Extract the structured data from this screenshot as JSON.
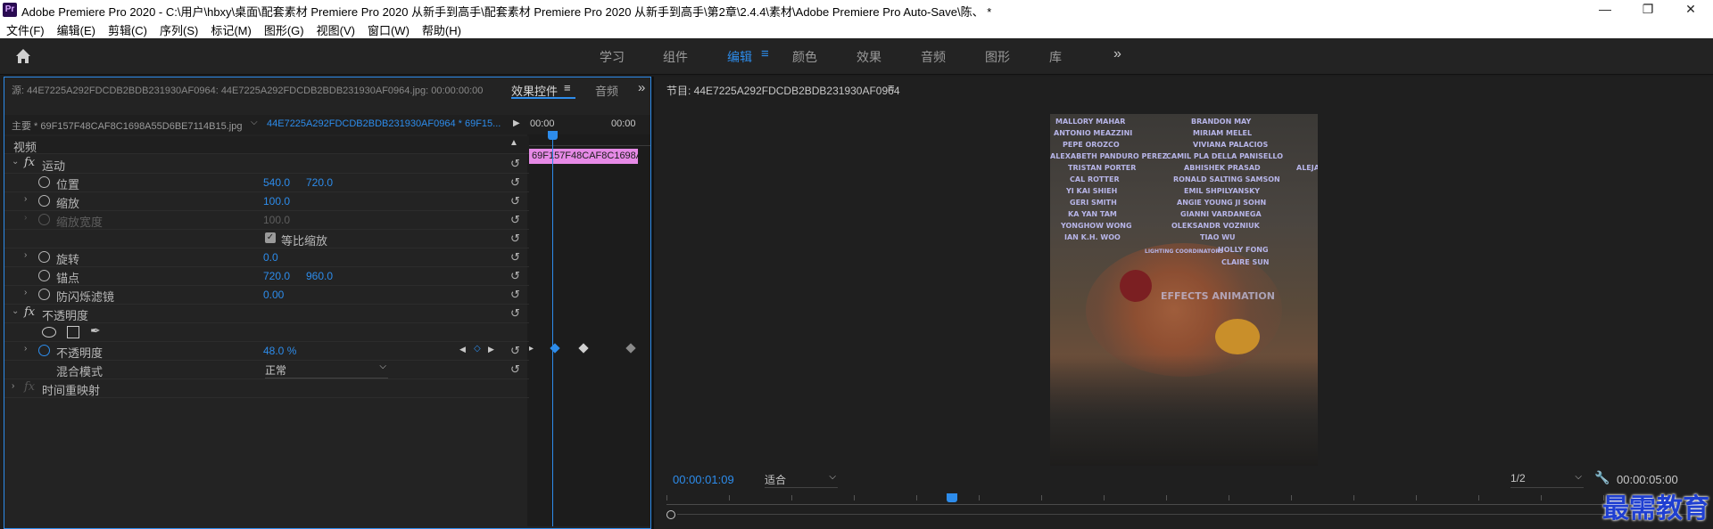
{
  "titlebar": {
    "icon": "Pr",
    "title": "Adobe Premiere Pro 2020 - C:\\用户\\hbxy\\桌面\\配套素材 Premiere Pro 2020 从新手到高手\\配套素材 Premiere Pro 2020 从新手到高手\\第2章\\2.4.4\\素材\\Adobe Premiere Pro Auto-Save\\陈、 *",
    "minimize": "—",
    "maximize": "❐",
    "close": "✕"
  },
  "menu": [
    "文件(F)",
    "编辑(E)",
    "剪辑(C)",
    "序列(S)",
    "标记(M)",
    "图形(G)",
    "视图(V)",
    "窗口(W)",
    "帮助(H)"
  ],
  "workspaces": {
    "items": [
      "学习",
      "组件",
      "编辑",
      "颜色",
      "效果",
      "音频",
      "图形",
      "库"
    ],
    "active": "编辑",
    "more": "»"
  },
  "left_panel": {
    "source_tab": "源: 44E7225A292FDCDB2BDB231930AF0964: 44E7225A292FDCDB2BDB231930AF0964.jpg: 00:00:00:00",
    "effect_controls_tab": "效果控件",
    "audio_tab": "音频",
    "more": "»",
    "master_clip": "主要 * 69F157F48CAF8C1698A55D6BE7114B15.jpg",
    "sequence_clip": "44E7225A292FDCDB2BDB231930AF0964 * 69F15...",
    "timeline_start": "00:00",
    "timeline_end": "00:00",
    "clip_bar": "69F157F48CAF8C1698A",
    "video_header": "视频",
    "motion": "运动",
    "position_label": "位置",
    "position_x": "540.0",
    "position_y": "720.0",
    "scale_label": "缩放",
    "scale_value": "100.0",
    "scale_width_label": "缩放宽度",
    "scale_width_value": "100.0",
    "uniform_scale": "等比缩放",
    "rotation_label": "旋转",
    "rotation_value": "0.0",
    "anchor_label": "锚点",
    "anchor_x": "720.0",
    "anchor_y": "960.0",
    "antiflicker_label": "防闪烁滤镜",
    "antiflicker_value": "0.00",
    "opacity_group": "不透明度",
    "opacity_label": "不透明度",
    "opacity_value": "48.0 %",
    "blend_label": "混合模式",
    "blend_value": "正常",
    "time_remap": "时间重映射",
    "reset_glyph": "↺"
  },
  "program": {
    "title": "节目: 44E7225A292FDCDB2BDB231930AF0964",
    "timecode": "00:00:01:09",
    "fit": "适合",
    "resolution": "1/2",
    "duration": "00:00:05:00",
    "frame_names": [
      "MALLORY MAHAR",
      "BRANDON MAY",
      "ANTONIO MEAZZINI",
      "MIRIAM MELEL",
      "PEPE OROZCO",
      "VIVIANA PALACIOS",
      "ALEXABETH PANDURO PEREZ",
      "CAMIL PLA DELLA PANISELLO",
      "TRISTAN PORTER",
      "ABHISHEK PRASAD",
      "CAL ROTTER",
      "RONALD SALTING SAMSON",
      "YI KAI SHIEH",
      "EMIL SHPILYANSKY",
      "GERI SMITH",
      "ANGIE YOUNG JI SOHN",
      "KA YAN TAM",
      "GIANNI VARDANEGA",
      "YONGHOW WONG",
      "OLEKSANDR VOZNIUK",
      "IAN K.H. WOO",
      "TIAO WU",
      "LIGHTING COORDINATORS",
      "HOLLY FONG",
      "CLAIRE SUN",
      "EFFECTS ANIMATION",
      "ALEJAN"
    ]
  },
  "watermark": "最需教育",
  "colors": {
    "accent": "#2d8ceb",
    "clip": "#e68ae6",
    "bg": "#1d1d1d"
  }
}
